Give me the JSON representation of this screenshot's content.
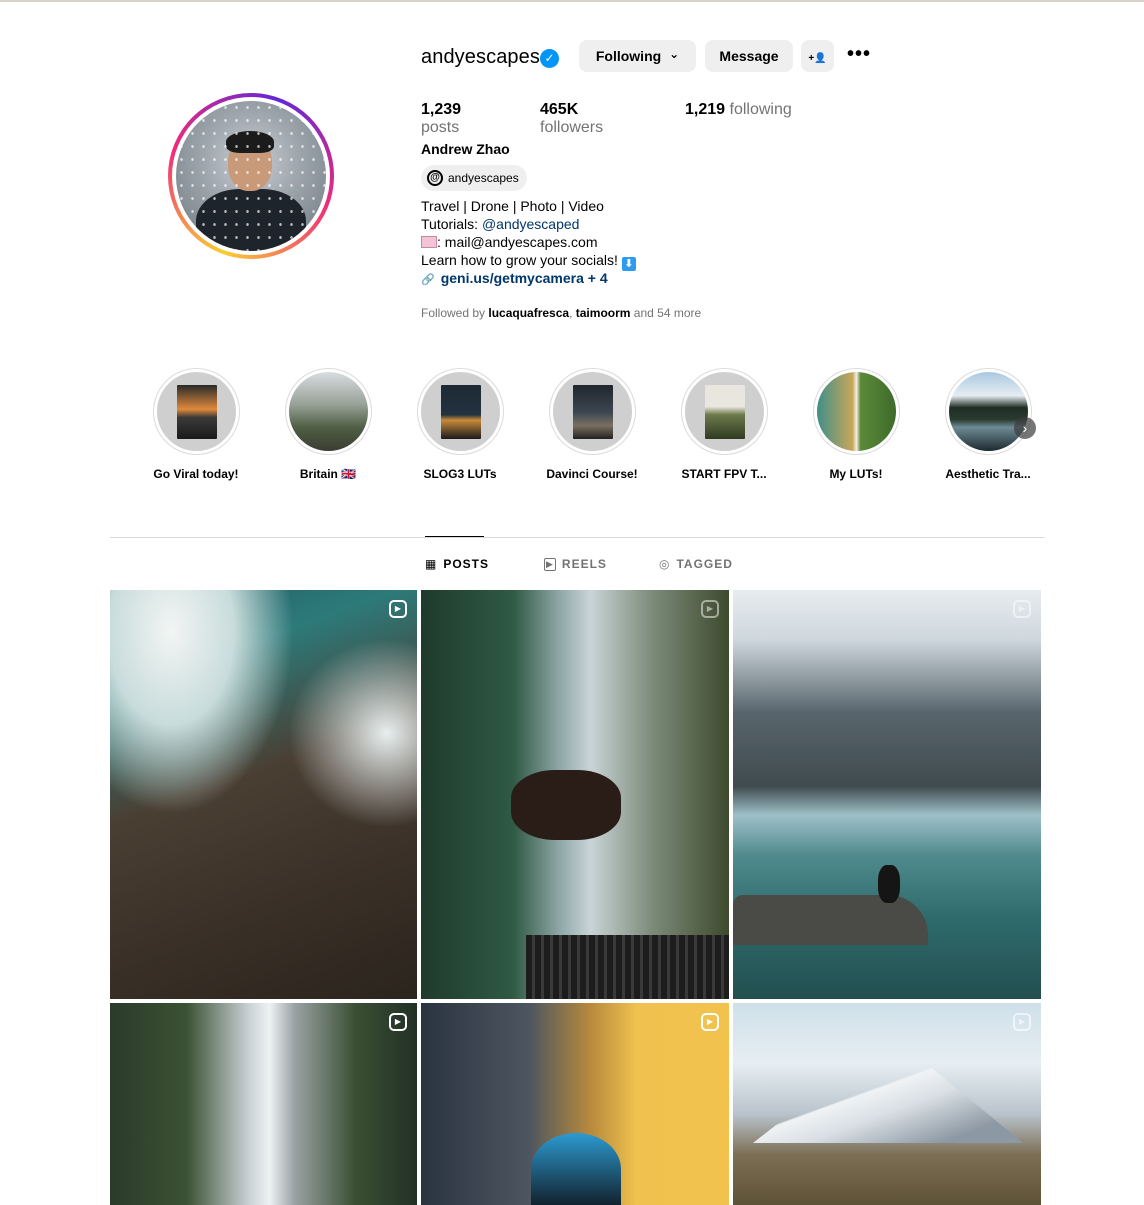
{
  "profile": {
    "username": "andyescapes",
    "verified_glyph": "✓",
    "buttons": {
      "following_label": "Following",
      "following_chevron": "⌄",
      "message_label": "Message",
      "add_user_glyph": "+👤",
      "more_glyph": "•••"
    },
    "stats": {
      "posts_count": "1,239",
      "posts_label": "posts",
      "followers_count": "465K",
      "followers_label": "followers",
      "following_count": "1,219",
      "following_label": "following"
    },
    "full_name": "Andrew Zhao",
    "threads_handle": "andyescapes",
    "threads_glyph": "@",
    "bio": {
      "line1": "Travel | Drone | Photo | Video",
      "line2_prefix": "Tutorials: ",
      "line2_tag": "@andyescaped",
      "line3_text": ": mail@andyescapes.com",
      "line4_text": "Learn how to grow your socials!",
      "line4_glyph": "⬇",
      "link_glyph": "🔗",
      "link_text": "geni.us/getmycamera",
      "link_more": " + 4"
    },
    "followed_by": {
      "prefix": "Followed by ",
      "user1": "lucaquafresca",
      "sep": ", ",
      "user2": "taimoorm",
      "suffix": " and 54 more"
    }
  },
  "highlights": [
    {
      "label": "Go Viral today!"
    },
    {
      "label": "Britain 🇬🇧"
    },
    {
      "label": "SLOG3 LUTs"
    },
    {
      "label": "Davinci Course!"
    },
    {
      "label": "START FPV T..."
    },
    {
      "label": "My LUTs!"
    },
    {
      "label": "Aesthetic Tra..."
    }
  ],
  "highlights_next_glyph": "›",
  "tabs": {
    "posts": {
      "label": "POSTS",
      "icon": "▦"
    },
    "reels": {
      "label": "REELS",
      "icon": "▶"
    },
    "tagged": {
      "label": "TAGGED",
      "icon": "◎"
    }
  },
  "reel_glyph": "▶",
  "colors": {
    "accent_blue": "#0095f6",
    "link_blue": "#00376b",
    "muted_text": "#737373",
    "button_bg": "#efefef"
  }
}
